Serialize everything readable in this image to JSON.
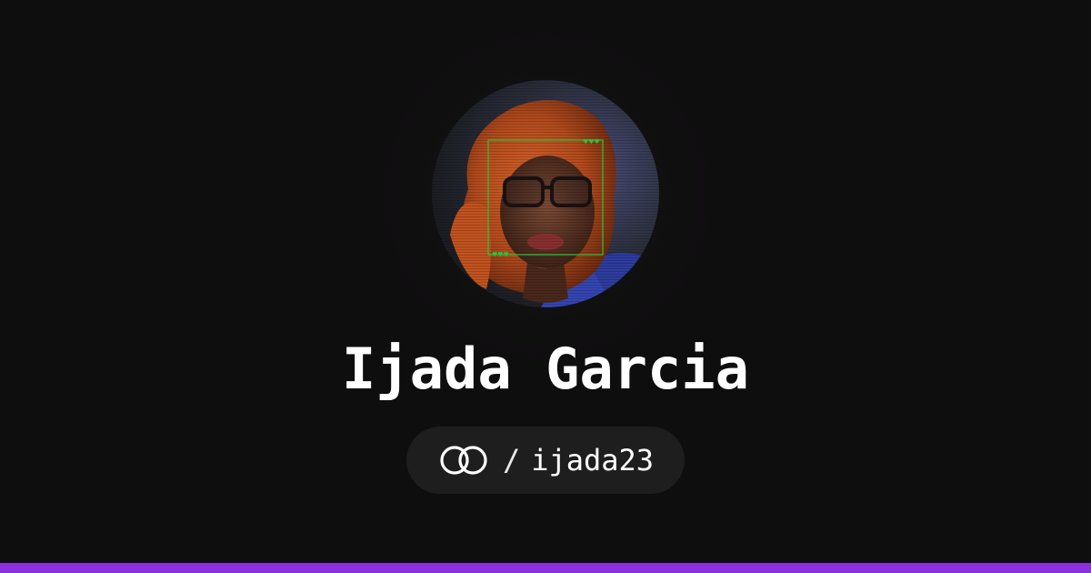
{
  "profile": {
    "name": "Ijada Garcia",
    "separator": "/",
    "handle": "ijada23",
    "avatar_alt": "profile photo"
  },
  "icons": {
    "logo": "interlocking-rings-icon"
  },
  "colors": {
    "background": "#0f0e0f",
    "pill": "#1f1e1f",
    "text": "#ffffff",
    "accent_bar": "#8b2fe0",
    "face_box": "#22c93a"
  }
}
